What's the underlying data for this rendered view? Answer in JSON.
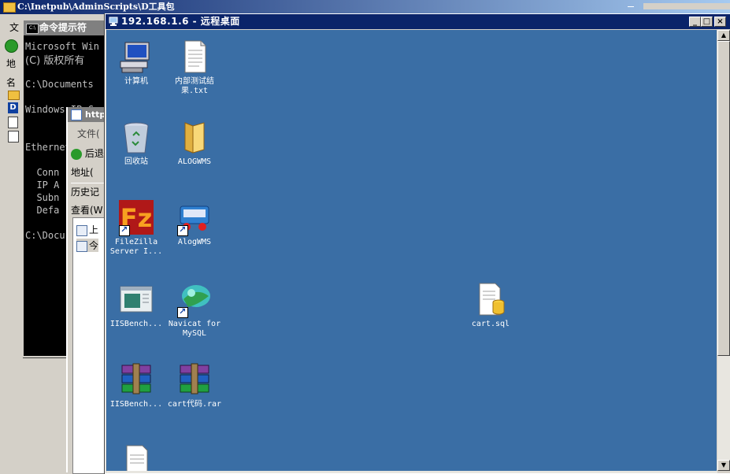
{
  "bg_explorer": {
    "title": "C:\\Inetpub\\AdminScripts\\",
    "title_suffix": "D工具包",
    "left_strip": [
      "文",
      "地",
      "名"
    ]
  },
  "cmd": {
    "title": "命令提示符",
    "lines": [
      "Microsoft Win",
      "(C) 版权所有",
      "C:\\Documents",
      "Windows IP C",
      "Ethernet",
      "  Conn",
      "  IP A",
      "  Subn",
      "  Defa",
      "C:\\Docu"
    ]
  },
  "browser": {
    "title": "http",
    "menu": "文件(",
    "back": "后退",
    "address": "地址(",
    "history": "历史记",
    "view": "查看(W",
    "items": [
      "上",
      "今"
    ]
  },
  "remote": {
    "title": "192.168.1.6 - 远程桌面",
    "minimize": "_",
    "maximize": "□",
    "close": "×"
  },
  "desktop_icons": [
    {
      "label": "计算机",
      "icon": "computer-icon"
    },
    {
      "label": "内部测试结果.txt",
      "icon": "text-file-icon"
    },
    {
      "label": "回收站",
      "icon": "recycle-bin-icon"
    },
    {
      "label": "ALOGWMS",
      "icon": "folder-icon"
    },
    {
      "label": "FileZilla Server I...",
      "icon": "filezilla-icon"
    },
    {
      "label": "AlogWMS",
      "icon": "alogwms-app-icon"
    },
    {
      "label": "IISBench...",
      "icon": "iisbench-icon"
    },
    {
      "label": "Navicat for MySQL",
      "icon": "navicat-icon"
    },
    {
      "label": "cart.sql",
      "icon": "sql-file-icon"
    },
    {
      "label": "IISBench...",
      "icon": "winrar-icon"
    },
    {
      "label": "cart代码.rar",
      "icon": "winrar-icon"
    }
  ],
  "colors": {
    "desktop": "#3a6ea5",
    "active_title": "#0a246a",
    "inactive_title": "#808080"
  }
}
